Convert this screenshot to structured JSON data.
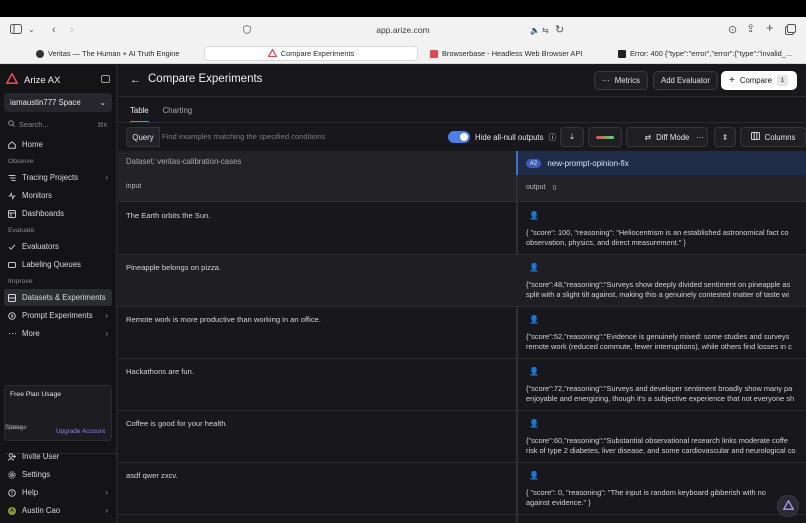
{
  "browser": {
    "url": "app.arize.com",
    "tabs": [
      {
        "label": "Veritas — The Human + AI Truth Engine",
        "active": false
      },
      {
        "label": "Compare Experiments",
        "active": true
      },
      {
        "label": "Browserbase - Headless Web Browser API",
        "active": false
      },
      {
        "label": "Error: 400 {\"type\":\"error\",\"error\":{\"type\":\"invalid_...",
        "active": false
      }
    ]
  },
  "sidebar": {
    "brand": "Arize AX",
    "space": "iamaustin777 Space",
    "search_placeholder": "Search...",
    "search_shortcut": "⌘K",
    "home": "Home",
    "sections": {
      "observe": "Observe",
      "evaluate": "Evaluate",
      "improve": "Improve"
    },
    "items": {
      "tracing": "Tracing Projects",
      "monitors": "Monitors",
      "dashboards": "Dashboards",
      "evaluators": "Evaluators",
      "labeling": "Labeling Queues",
      "datasets": "Datasets & Experiments",
      "prompt": "Prompt Experiments",
      "more": "More"
    },
    "usage": {
      "title": "Free Plan Usage",
      "spans": "Spans",
      "storage": "Storage",
      "upgrade": "Upgrade Account",
      "spans_fill": 0,
      "storage_fill": 0
    },
    "footer": {
      "invite": "Invite User",
      "settings": "Settings",
      "help": "Help",
      "user": "Austin Cao",
      "user_initial": "A"
    }
  },
  "header": {
    "title": "Compare Experiments",
    "metrics": "Metrics",
    "add_evaluator": "Add Evaluator",
    "compare": "Compare",
    "compare_count": "1"
  },
  "view_tabs": {
    "table": "Table",
    "charting": "Charting"
  },
  "query": {
    "label": "Query",
    "placeholder": "Find examples matching the specified conditions",
    "hide_null_label": "Hide all-null outputs",
    "diff_mode": "Diff Mode",
    "columns": "Columns"
  },
  "table": {
    "dataset_label": "Dataset: veritas-calibration-cases",
    "input_header": "input",
    "experiment_badge": "#2",
    "experiment_name": "new-prompt-opinion-fix",
    "output_header": "output",
    "rows": [
      {
        "input": "The Earth orbits the Sun.",
        "output": "{ \"score\": 100, \"reasoning\": \"Heliocentrism is an established astronomical fact co\nobservation, physics, and direct measurement.\" }"
      },
      {
        "input": "Pineapple belongs on pizza.",
        "output": "{\"score\":48,\"reasoning\":\"Surveys show deeply divided sentiment on pineapple as\nsplit with a slight tilt against, making this a genuinely contested matter of taste wi"
      },
      {
        "input": "Remote work is more productive than working in an office.",
        "output": "{\"score\":52,\"reasoning\":\"Evidence is genuinely mixed: some studies and surveys\nremote work (reduced commute, fewer interruptions), while others find losses in c"
      },
      {
        "input": "Hackathons are fun.",
        "output": "{\"score\":72,\"reasoning\":\"Surveys and developer sentiment broadly show many pa\nenjoyable and energizing, though it's a subjective experience that not everyone sh"
      },
      {
        "input": "Coffee is good for your health.",
        "output": "{\"score\":60,\"reasoning\":\"Substantial observational research links moderate coffe\nrisk of type 2 diabetes, liver disease, and some cardiovascular and neurological co"
      },
      {
        "input": "asdf qwer zxcv.",
        "output": "{ \"score\": 0, \"reasoning\": \"The input is random keyboard gibberish with no\nagainst evidence.\" }"
      }
    ]
  },
  "colors": {
    "accent": "#4a7fe6",
    "brand": "#e5484d",
    "upgrade": "#9c7cf5"
  }
}
